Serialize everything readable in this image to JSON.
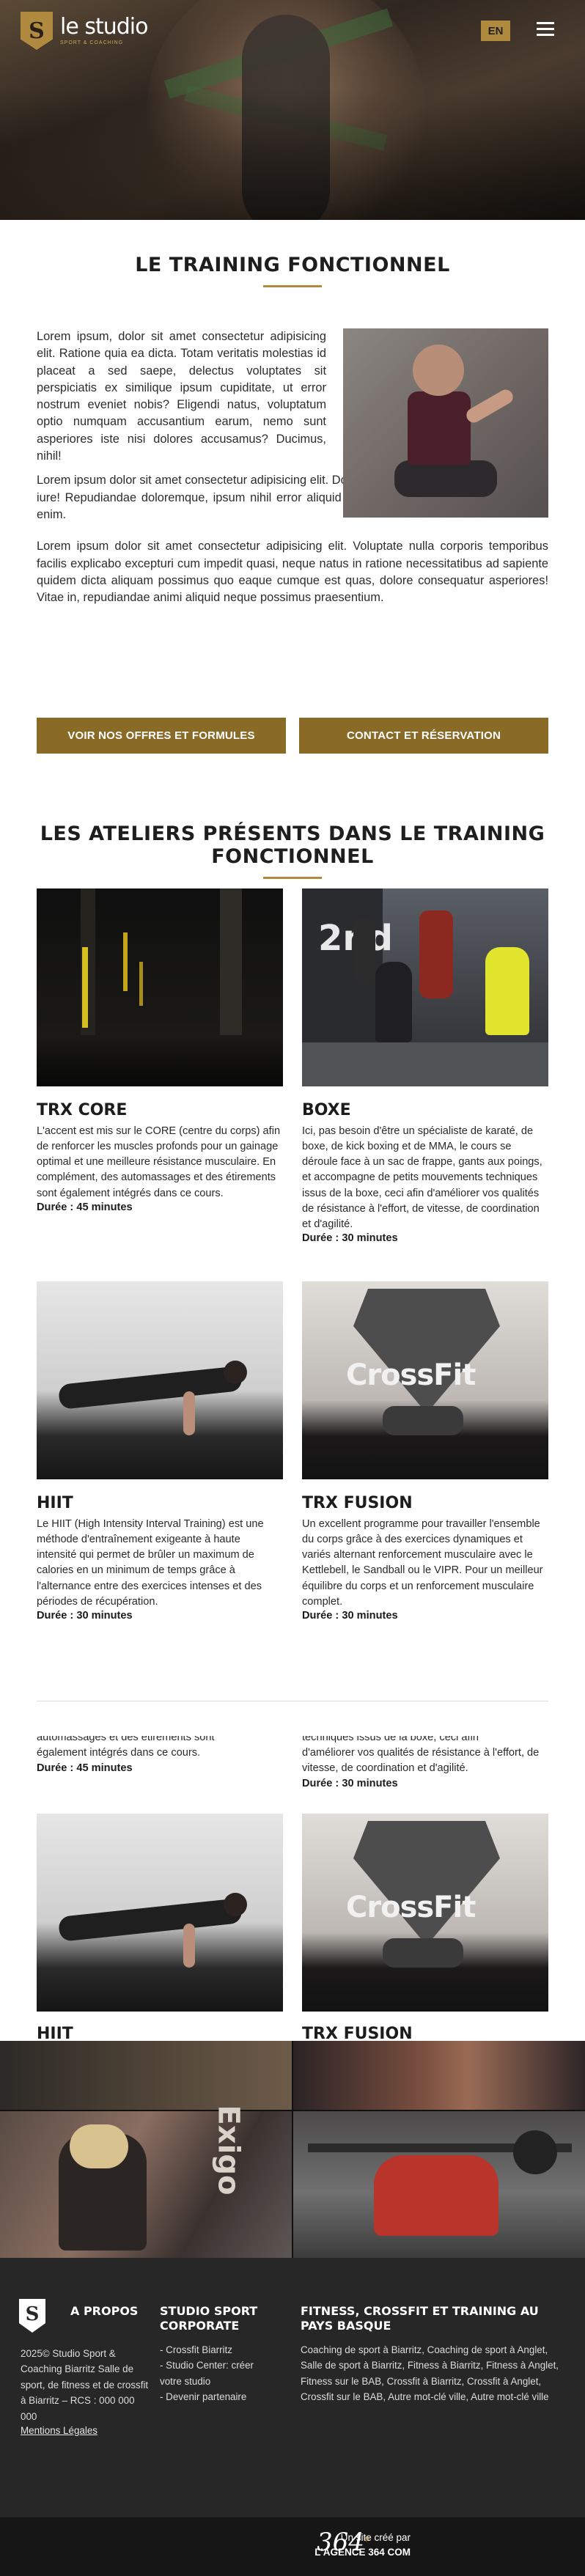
{
  "header": {
    "logo_text": "le studio",
    "logo_subtitle": "SPORT & COACHING",
    "logo_letter": "S",
    "lang": "EN"
  },
  "intro": {
    "title": "LE TRAINING FONCTIONNEL",
    "p1": "Lorem ipsum, dolor sit amet consectetur adipisicing elit. Ratione quia ea dicta. Totam veritatis molestias id placeat a sed saepe, delectus voluptates sit perspiciatis ex similique ipsum cupiditate, ut error nostrum eveniet nobis? Eligendi natus, voluptatum optio numquam accusantium earum, nemo sunt asperiores iste nisi dolores accusamus? Ducimus, nihil!",
    "p2": "Lorem ipsum dolor sit amet consectetur adipisicing elit. Dolores eligendi suscipit veritatis veniam iure! Repudiandae doloremque, ipsum nihil error aliquid delectus veritatis esse deleniti saepe enim.",
    "p3": "Lorem ipsum dolor sit amet consectetur adipisicing elit. Voluptate nulla corporis temporibus facilis explicabo excepturi cum impedit quasi, neque natus in ratione necessitatibus ad sapiente quidem dicta aliquam possimus quo eaque cumque est quas, dolore consequatur asperiores! Vitae in, repudiandae animi aliquid neque possimus praesentium.",
    "cta_offres": "VOIR NOS OFFRES ET FORMULES",
    "cta_contact": "CONTACT ET RÉSERVATION"
  },
  "ateliers": {
    "title": "LES ATELIERS PRÉSENTS DANS LE TRAINING FONCTIONNEL",
    "boxe_wall_text": "2nd",
    "fusion_logo_text": "CrossFit",
    "items": [
      {
        "name": "TRX CORE",
        "text": "L'accent est mis sur le CORE (centre du corps) afin de renforcer les muscles profonds pour un gainage optimal et une meilleure résistance musculaire. En complément, des automassages et des étirements sont également intégrés dans ce cours.",
        "duration": "Durée : 45 minutes"
      },
      {
        "name": "BOXE",
        "text": "Ici, pas besoin d'être un spécialiste de karaté, de boxe, de kick boxing et de MMA, le cours se déroule face à un sac de frappe, gants aux poings, et accompagne de petits mouvements techniques issus de la boxe, ceci afin d'améliorer vos qualités de résistance à l'effort, de vitesse, de coordination et d'agilité.",
        "duration": "Durée : 30 minutes"
      },
      {
        "name": "HIIT",
        "text": "Le HIIT (High Intensity Interval Training) est une méthode d'entraînement exigeante à haute intensité qui permet de brûler un maximum de calories en un minimum de temps grâce à l'alternance entre des exercices intenses et des périodes de récupération.",
        "duration": "Durée : 30 minutes"
      },
      {
        "name": "TRX FUSION",
        "text": "Un excellent programme pour travailler l'ensemble du corps grâce à des exercices dynamiques et variés alternant renforcement musculaire avec le Kettlebell, le Sandball ou le VIPR. Pour un meilleur équilibre du corps et un renforcement musculaire complet.",
        "duration": "Durée : 30 minutes"
      }
    ]
  },
  "repeat": {
    "left_partial": "automassages et des étirements sont",
    "left_line": "également intégrés dans ce cours.",
    "left_duration": "Durée : 45 minutes",
    "right_partial": "techniques issus de la boxe, ceci afin",
    "right_line": "d'améliorer vos qualités de résistance à l'effort, de vitesse, de coordination et d'agilité.",
    "right_duration": "Durée : 30 minutes",
    "hiit": "HIIT",
    "fusion": "TRX FUSION"
  },
  "mosaic": {
    "brand_text": "Exigo"
  },
  "footer": {
    "col1_title": "A PROPOS",
    "col1_text": "2025© Studio Sport & Coaching Biarritz Salle de sport, de fitness et de crossfit à Biarritz – RCS : 000 000 000",
    "col1_link": "Mentions Légales",
    "col2_title": "STUDIO SPORT CORPORATE",
    "col2_items": [
      "- Crossfit Biarritz",
      "- Studio Center: créer votre studio",
      "- Devenir partenaire"
    ],
    "col3_title": "FITNESS, CROSSFIT ET TRAINING AU PAYS BASQUE",
    "col3_text": "Coaching de sport à Biarritz, Coaching de sport à Anglet, Salle de sport à Biarritz, Fitness à Biarritz, Fitness à Anglet, Fitness sur le BAB, Crossfit à Biarritz, Crossfit à Anglet, Crossfit sur le BAB, Autre mot-clé ville, Autre mot-clé ville",
    "credit_line1": "Un site créé par",
    "credit_line2": "L'AGENCE 364 COM",
    "credit_logo": "364",
    "credit_logo_sup": "o"
  },
  "colors": {
    "accent": "#8a6a27",
    "accent_light": "#b08a3e",
    "footer_bg": "#272727",
    "credit_bg": "#161616"
  }
}
